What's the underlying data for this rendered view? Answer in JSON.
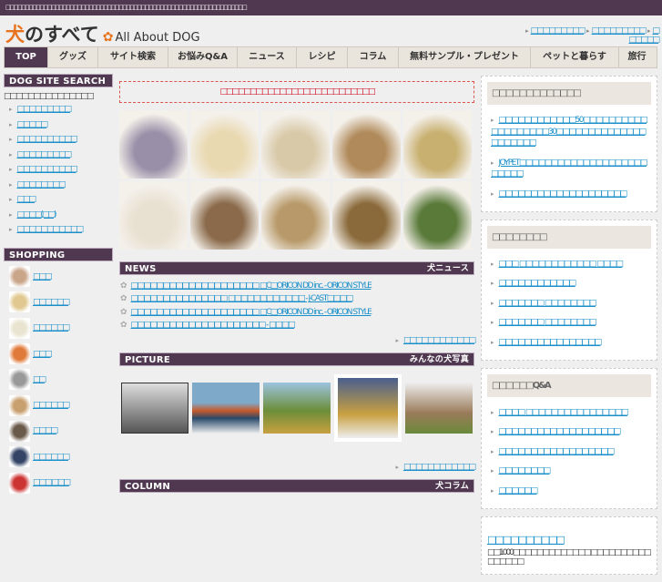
{
  "topbar": {
    "text": "□□□□□□□□□□□□□□□□□□□□□□□□□□□□□□□□□□□□□□□□□□□□□□□□□□□□□□□□□□□□□□□□"
  },
  "logo": {
    "inu": "犬",
    "rest": "のすべて",
    "paw": "🐾",
    "en": "All About DOG"
  },
  "toplinks": [
    "□□□□□□□□□",
    "□□□□□□□□□",
    "□□□□□□"
  ],
  "nav": [
    "TOP",
    "グッズ",
    "サイト検索",
    "お悩みQ&A",
    "ニュース",
    "レシピ",
    "コラム",
    "無料サンプル・プレゼント",
    "ペットと暮らす",
    "旅行"
  ],
  "left": {
    "search_title": "DOG SITE SEARCH",
    "search_intro": "□□□□□□□□□□□□□□□",
    "search_links": [
      "□□□□□□□□□",
      "□□□□□",
      "□□□□□□□□□□",
      "□□□□□□□□□",
      "□□□□□□□□□□",
      "□□□□□□□□",
      "□□□",
      "□□□□(□□)",
      "□□□□□□□□□□□"
    ],
    "shop_title": "SHOPPING",
    "shop_links": [
      "□□□",
      "□□□□□□",
      "□□□□□□",
      "□□□",
      "□□",
      "□□□□□□",
      "□□□□",
      "□□□□□□",
      "□□□ □□□"
    ]
  },
  "center": {
    "notice": "□□□□□□□□□□□□□□□□□□□□□□□□□□",
    "news_title": "NEWS",
    "news_sub": "犬ニュース",
    "news": [
      "□□□□□□□□□□□□□□□□□□□□ □C□ORICON DD inc. - ORICON STYLE",
      "□□□□□□□□□□□□□□□ □□□□□□□□□□□□ - J-CAST□□□□",
      "□□□□□□□□□□□□□□□□□□□□ □C□ORICON DD inc. - ORICON STYLE",
      "□□□□□□□□□□□□□□□□□□□□□ - □□□□"
    ],
    "news_more": "□□□□□□□□□□□□",
    "pic_title": "PICTURE",
    "pic_sub": "みんなの犬写真",
    "pic_more": "□□□□□□□□□□□□",
    "col_title": "COLUMN",
    "col_sub": "犬コラム"
  },
  "right": {
    "box1": {
      "title": "□□□□□□□□□□□□□",
      "links": [
        "□□□□□□□□□□□□50□□□□□□□□□□□□□□□□□□□30□□□□□□□□□□□□□□□□□□□□□",
        "JOYPET□□□□□□□□□□□□□□□□□□□□□□□□□",
        "□□□□□□□□□□□□□□□□□□□□"
      ]
    },
    "box2": {
      "title": "□□□□□□□□",
      "links": [
        "□□□ □□□□□□□□□□□□ □□□□",
        "□□□□□□□□□□□□",
        "□□□□□□□ □□□□□□□□",
        "□□□□□□□ □□□□□□□□",
        "□□□□□□□□□□□□□□□□"
      ]
    },
    "box3": {
      "title": "□□□□□□Q&A",
      "links": [
        "□□□□ □□□□□□□□□□□□□□□□",
        "□□□□□□□□□□□□□□□□□□□",
        "□□□□□□□□□□□□□□□□□□",
        "□□□□□□□□",
        "□□□□□□"
      ]
    },
    "box4": {
      "title": "□□□□□□□□□□",
      "text": "□□1000□□□□□□□□□□□□□ □□□□□□□□□□□□□□□□"
    }
  }
}
